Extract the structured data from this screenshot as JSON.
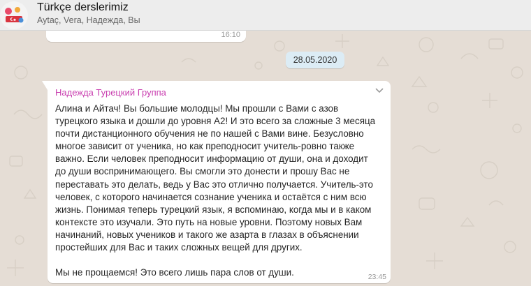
{
  "header": {
    "title": "Türkçe derslerimiz",
    "members": "Aytaç, Vera, Надежда, Вы"
  },
  "previous_message": {
    "time": "16:10",
    "icon": "clapping-hands-emoji"
  },
  "date_separator": "28.05.2020",
  "message": {
    "sender": "Надежда Турецкий Группа",
    "sender_color": "#c940b0",
    "text": "Алина и Айтач! Вы большие молодцы! Мы прошли с Вами с азов\nтурецкого языка и дошли до уровня А2! И это всего за сложные 3 месяца\nпочти дистанционного обучения не по нашей с Вами вине. Безусловно\nмногое зависит от ученика, но как преподносит учитель-ровно также\nважно. Если человек преподносит информацию от души, она и доходит\nдо души воспринимающего. Вы смогли это донести и прошу Вас не\nпереставать это делать, ведь у Вас это отлично получается. Учитель-это\nчеловек, с которого начинается сознание ученика и остаётся с ним всю\nжизнь. Понимая теперь турецкий язык, я вспоминаю, когда мы и в каком\nконтексте это изучали. Это путь на новые уровни. Поэтому новых Вам\nначинаний, новых учеников и такого же азарта в глазах в объяснении\nпростейших для Вас и таких сложных вещей для других.\n\nМы не прощаемся! Это всего лишь пара слов от души.",
    "time": "23:45"
  },
  "colors": {
    "wallpaper": "#e5ddd5",
    "bubble": "#ffffff",
    "date_chip": "#dcecf5",
    "header": "#ededed"
  }
}
